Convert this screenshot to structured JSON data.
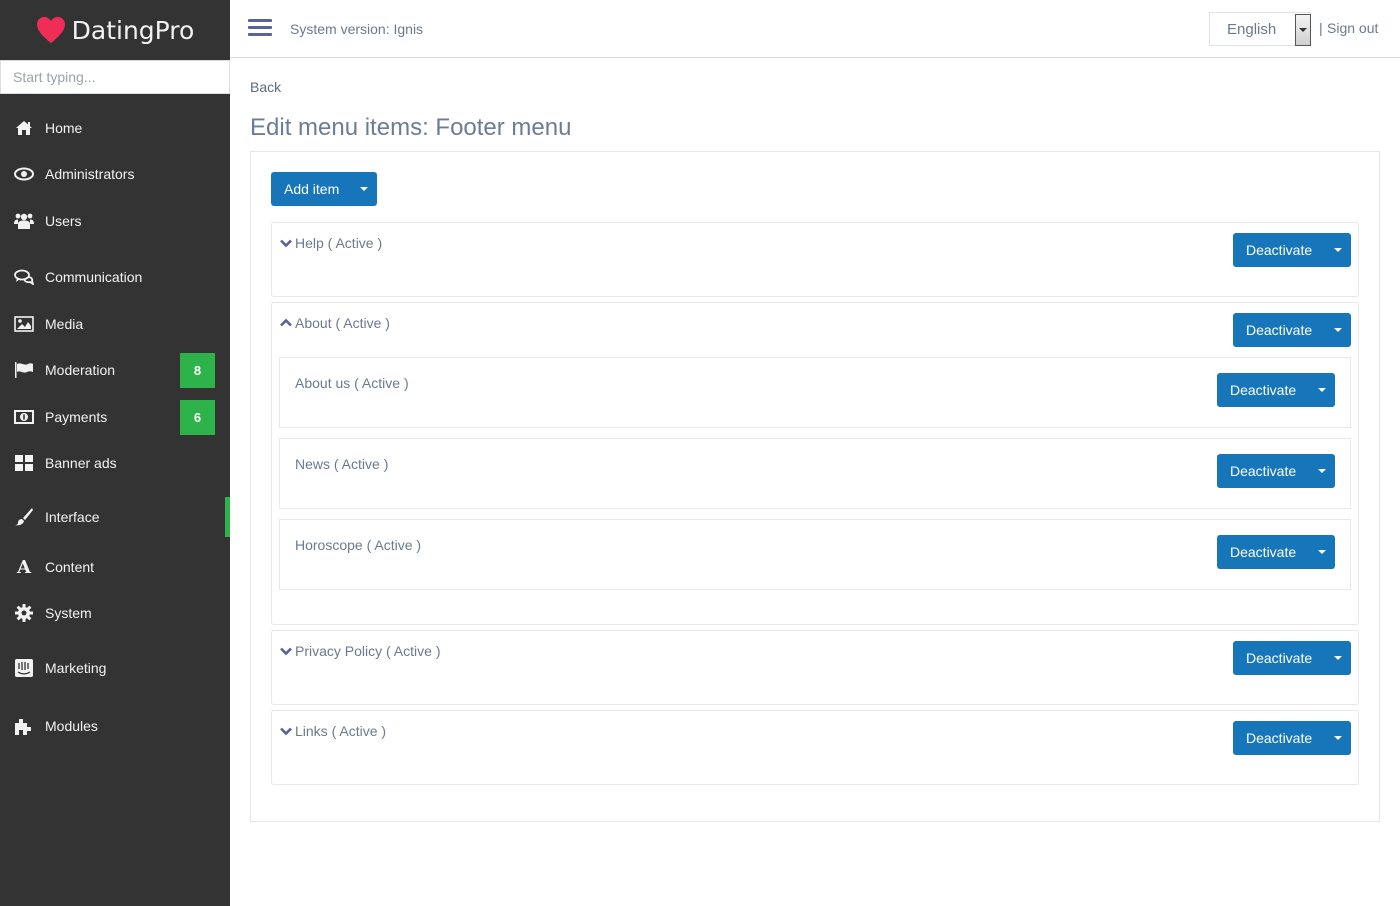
{
  "brand": {
    "name": "DatingPro",
    "heart_color": "#ef2d56"
  },
  "search": {
    "placeholder": "Start typing..."
  },
  "sidebar": {
    "items": [
      {
        "label": "Home",
        "icon": "home-icon"
      },
      {
        "label": "Administrators",
        "icon": "eye-icon"
      },
      {
        "label": "Users",
        "icon": "users-icon"
      },
      {
        "label": "Communication",
        "icon": "comments-icon"
      },
      {
        "label": "Media",
        "icon": "image-icon"
      },
      {
        "label": "Moderation",
        "icon": "flag-icon",
        "badge": "8"
      },
      {
        "label": "Payments",
        "icon": "money-icon",
        "badge": "6"
      },
      {
        "label": "Banner ads",
        "icon": "grid-icon"
      },
      {
        "label": "Interface",
        "icon": "brush-icon",
        "active": true
      },
      {
        "label": "Content",
        "icon": "font-icon"
      },
      {
        "label": "System",
        "icon": "gear-icon"
      },
      {
        "label": "Marketing",
        "icon": "intercom-icon"
      },
      {
        "label": "Modules",
        "icon": "puzzle-icon"
      }
    ],
    "accent_color": "#2db34a"
  },
  "topbar": {
    "system_version": "System version: Ignis",
    "language": "English",
    "separator": "|",
    "sign_out": "Sign out"
  },
  "main": {
    "back": "Back",
    "title": "Edit menu items: Footer menu",
    "add_item": "Add item",
    "button_color": "#1776b9",
    "items": [
      {
        "title": "Help ( Active )",
        "action": "Deactivate",
        "expanded": false
      },
      {
        "title": "About ( Active )",
        "action": "Deactivate",
        "expanded": true,
        "children": [
          {
            "title": "About us ( Active )",
            "action": "Deactivate"
          },
          {
            "title": "News ( Active )",
            "action": "Deactivate"
          },
          {
            "title": "Horoscope ( Active )",
            "action": "Deactivate"
          }
        ]
      },
      {
        "title": "Privacy Policy ( Active )",
        "action": "Deactivate",
        "expanded": false
      },
      {
        "title": "Links ( Active )",
        "action": "Deactivate",
        "expanded": false
      }
    ]
  }
}
